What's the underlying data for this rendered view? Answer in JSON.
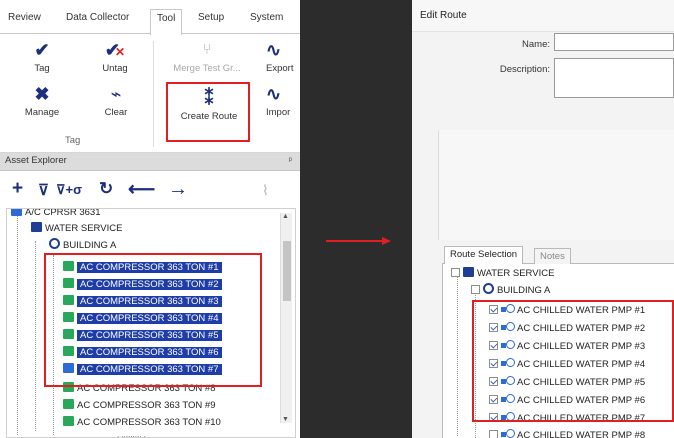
{
  "left": {
    "tabs": [
      "Review",
      "Data Collector",
      "Tool",
      "Setup",
      "System"
    ],
    "ribbon": {
      "tag": "Tag",
      "untag": "Untag",
      "merge_test": "Merge Test Gr...",
      "export": "Export",
      "manage": "Manage",
      "clear": "Clear",
      "create_route": "Create Route",
      "import": "Impor",
      "group_label": "Tag"
    },
    "explorer": {
      "title": "Asset Explorer",
      "pin": "ᵖ",
      "tree": {
        "top_item": "A/C CPRSR 3631",
        "water_service": "WATER SERVICE",
        "building": "BUILDING A",
        "items": [
          "AC COMPRESSOR 363 TON #1",
          "AC COMPRESSOR 363 TON #2",
          "AC COMPRESSOR 363 TON #3",
          "AC COMPRESSOR 363 TON #4",
          "AC COMPRESSOR 363 TON #5",
          "AC COMPRESSOR 363 TON #6",
          "AC COMPRESSOR 363 TON #7",
          "AC COMPRESSOR 363 TON #8",
          "AC COMPRESSOR 363 TON #9",
          "AC COMPRESSOR 363 TON #10"
        ],
        "bottom_dots": ". ......... ."
      }
    }
  },
  "right": {
    "title": "Edit Route",
    "name_label": "Name:",
    "description_label": "Description:",
    "tabs": [
      "Route Selection",
      "Notes"
    ],
    "tree": {
      "water_service": "WATER SERVICE",
      "building": "BUILDING A",
      "items": [
        "AC CHILLED WATER PMP #1",
        "AC CHILLED WATER PMP #2",
        "AC CHILLED WATER PMP #3",
        "AC CHILLED WATER PMP #4",
        "AC CHILLED WATER PMP #5",
        "AC CHILLED WATER PMP #6",
        "AC CHILLED WATER PMP #7",
        "AC CHILLED WATER PMP #8"
      ]
    }
  },
  "colors": {
    "highlight_box": "#e02020",
    "selection": "#1e3da8",
    "divider": "#2c2c2c",
    "icon_navy": "#1b2f7e"
  }
}
